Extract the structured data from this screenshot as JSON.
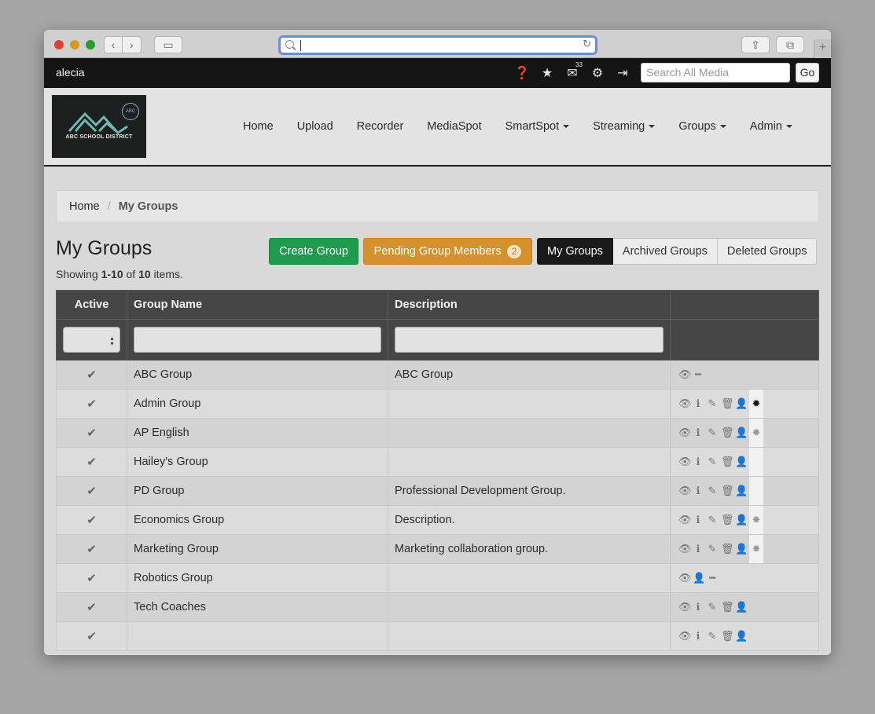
{
  "browser": {
    "url": ""
  },
  "topbar": {
    "username": "alecia",
    "mail_count": "33",
    "search_placeholder": "Search All Media",
    "go_label": "Go"
  },
  "logo": {
    "title": "ABC SCHOOL DISTRICT",
    "badge": "ABC"
  },
  "nav": [
    {
      "label": "Home",
      "dropdown": false
    },
    {
      "label": "Upload",
      "dropdown": false
    },
    {
      "label": "Recorder",
      "dropdown": false
    },
    {
      "label": "MediaSpot",
      "dropdown": false
    },
    {
      "label": "SmartSpot",
      "dropdown": true
    },
    {
      "label": "Streaming",
      "dropdown": true
    },
    {
      "label": "Groups",
      "dropdown": true
    },
    {
      "label": "Admin",
      "dropdown": true
    }
  ],
  "breadcrumb": {
    "home": "Home",
    "separator": "/",
    "current": "My Groups"
  },
  "page": {
    "title": "My Groups",
    "showing_prefix": "Showing ",
    "showing_range": "1-10",
    "showing_of": " of ",
    "showing_total": "10",
    "showing_suffix": " items."
  },
  "buttons": {
    "create": "Create Group",
    "pending": "Pending Group Members",
    "pending_count": "2",
    "tab_my": "My Groups",
    "tab_archived": "Archived Groups",
    "tab_deleted": "Deleted Groups"
  },
  "table": {
    "headers": {
      "active": "Active",
      "name": "Group Name",
      "description": "Description",
      "actions": ""
    },
    "rows": [
      {
        "active": "✔",
        "name": "ABC Group",
        "description": "ABC Group",
        "actions": [
          "view",
          "minus"
        ],
        "cert": "none"
      },
      {
        "active": "✔",
        "name": "Admin Group",
        "description": "",
        "actions": [
          "view",
          "info",
          "edit",
          "delete",
          "user"
        ],
        "cert": "dark"
      },
      {
        "active": "✔",
        "name": "AP English",
        "description": "",
        "actions": [
          "view",
          "info",
          "edit",
          "delete",
          "user"
        ],
        "cert": "light"
      },
      {
        "active": "✔",
        "name": "Hailey's Group",
        "description": "",
        "actions": [
          "view",
          "info",
          "edit",
          "delete",
          "user"
        ],
        "cert": "empty"
      },
      {
        "active": "✔",
        "name": "PD Group",
        "description": "Professional Development Group.",
        "actions": [
          "view",
          "info",
          "edit",
          "delete",
          "user"
        ],
        "cert": "empty"
      },
      {
        "active": "✔",
        "name": "Economics Group",
        "description": "Description.",
        "actions": [
          "view",
          "info",
          "edit",
          "delete",
          "user"
        ],
        "cert": "light"
      },
      {
        "active": "✔",
        "name": "Marketing Group",
        "description": "Marketing collaboration group.",
        "actions": [
          "view",
          "info",
          "edit",
          "delete",
          "user"
        ],
        "cert": "light"
      },
      {
        "active": "✔",
        "name": "Robotics Group",
        "description": "",
        "actions": [
          "view",
          "user",
          "minus"
        ],
        "cert": "none"
      },
      {
        "active": "✔",
        "name": "Tech Coaches",
        "description": "",
        "actions": [
          "view",
          "info",
          "edit",
          "delete",
          "user"
        ],
        "cert": "none"
      },
      {
        "active": "✔",
        "name": "",
        "description": "",
        "actions": [
          "view",
          "info",
          "edit",
          "delete",
          "user"
        ],
        "cert": "none"
      }
    ]
  },
  "icons": {
    "view": "👁",
    "info": "ℹ",
    "edit": "✎",
    "delete": "🗑",
    "user": "👤",
    "minus": "━",
    "cert": "✹"
  }
}
